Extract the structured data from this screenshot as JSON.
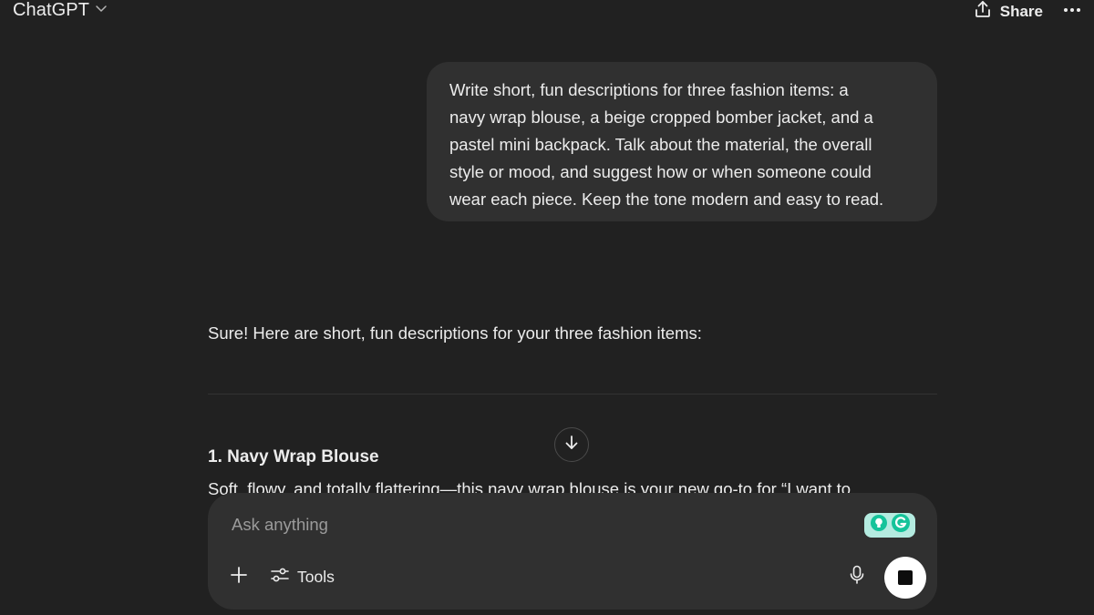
{
  "header": {
    "model_name": "ChatGPT",
    "share_label": "Share"
  },
  "messages": {
    "user": {
      "lines": [
        "Write short, fun descriptions for three fashion items: a",
        "navy wrap blouse, a beige cropped bomber jacket, and a",
        "pastel mini backpack. Talk about the material, the overall",
        "style or mood, and suggest how or when someone could",
        "wear each piece. Keep the tone modern and easy to read."
      ]
    },
    "assistant": {
      "intro": "Sure! Here are short, fun descriptions for your three fashion items:",
      "item1_heading": "1. Navy Wrap Blouse",
      "item1_body": "Soft, flowy, and totally flattering—this navy wrap blouse is your new go-to for “I want to"
    }
  },
  "composer": {
    "placeholder": "Ask anything",
    "tools_label": "Tools"
  },
  "icons": {
    "model_chevron": "chevron-down-icon",
    "share": "share-icon",
    "more": "more-dots-icon",
    "scroll": "arrow-down-icon",
    "plus": "plus-icon",
    "tools": "sliders-icon",
    "mic": "microphone-icon",
    "stop": "stop-icon",
    "grammarly": "grammarly-icon"
  },
  "colors": {
    "background": "#212121",
    "bubble": "#303030",
    "text": "#ececec",
    "placeholder": "#9b9b9b",
    "grammarly_bg": "#b4ebe0",
    "grammarly_accent": "#15c39a"
  }
}
